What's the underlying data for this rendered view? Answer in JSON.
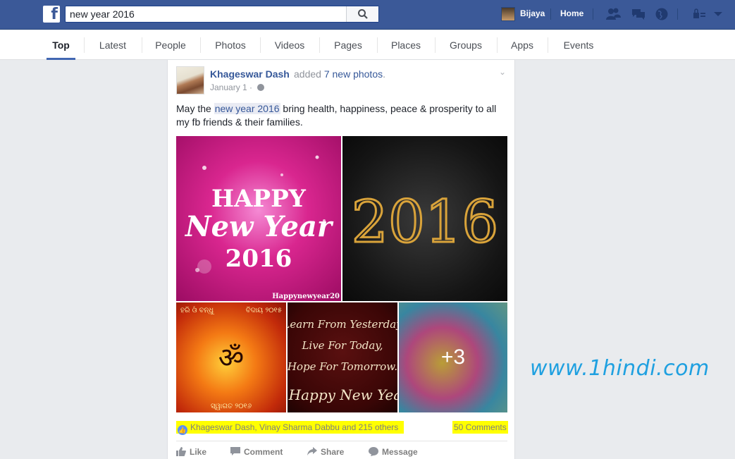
{
  "topbar": {
    "logo_letter": "f",
    "search_value": "new year 2016",
    "user_name": "Bijaya",
    "home_label": "Home"
  },
  "tabs": [
    {
      "label": "Top",
      "active": true
    },
    {
      "label": "Latest"
    },
    {
      "label": "People"
    },
    {
      "label": "Photos"
    },
    {
      "label": "Videos"
    },
    {
      "label": "Pages"
    },
    {
      "label": "Places"
    },
    {
      "label": "Groups"
    },
    {
      "label": "Apps"
    },
    {
      "label": "Events"
    }
  ],
  "post": {
    "author": "Khageswar Dash",
    "action_prefix": "added ",
    "action_link": "7 new photos",
    "action_suffix": ".",
    "date": "January 1",
    "date_sep": "·",
    "text_before": "May the ",
    "text_highlight": "new year 2016",
    "text_after": " bring health, happiness, peace & prosperity to all my fb friends & their families.",
    "photo_more": "+3",
    "likes_text": "Khageswar Dash, Vinay Sharma Dabbu and 215 others",
    "comments_text": "50 Comments",
    "actions": {
      "like": "Like",
      "comment": "Comment",
      "share": "Share",
      "message": "Message"
    },
    "photo_texts": {
      "p1_line1": "HAPPY",
      "p1_line2": "New Year",
      "p1_line3": "2016",
      "p1_footer": "Happynewyear20",
      "p2_number": "2016",
      "p3_top_left": "ହରି ଓଁ ବନ୍ଧୁ",
      "p3_top_right": "ବିଦାୟ ୨୦୧୫",
      "p3_symbol": "ॐ",
      "p3_bottom": "ସ୍ୱାଗତ ୨୦୧୬",
      "p4_line1": "Learn From Yesterday",
      "p4_line2": "Live For Today,",
      "p4_line3": "Hope For Tomorrow.",
      "p4_line4": "Happy New Yea"
    }
  },
  "watermark": "www.1hindi.com",
  "colors": {
    "topbar": "#3b5998",
    "link": "#365899",
    "highlight": "#ffff00",
    "watermark": "#1fa0e0"
  }
}
